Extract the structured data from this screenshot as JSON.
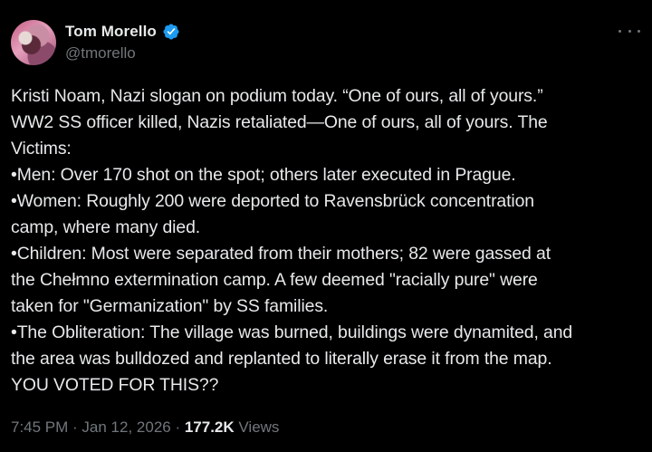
{
  "user": {
    "display_name": "Tom Morello",
    "handle": "@tmorello",
    "verified_color": "#1d9bf0"
  },
  "tweet": {
    "lines": [
      "Kristi Noam, Nazi slogan on podium today. “One of ours, all of yours.”",
      "WW2 SS officer killed, Nazis retaliated—One of ours, all of yours. The",
      "Victims:",
      "•Men: Over 170 shot on the spot; others later executed in Prague.",
      "•Women: Roughly 200 were deported to Ravensbrück concentration",
      "camp, where many died.",
      "•Children: Most were separated from their mothers; 82 were gassed at",
      "the Chełmno extermination camp. A few deemed \"racially pure\" were",
      "taken for \"Germanization\" by SS families.",
      "•The Obliteration: The village was burned, buildings were dynamited, and",
      "the area was bulldozed and replanted to literally erase it from the map.",
      "YOU VOTED FOR THIS??"
    ]
  },
  "meta": {
    "time": "7:45 PM",
    "sep1": " · ",
    "date": "Jan 12, 2026",
    "sep2": " · ",
    "views_count": "177.2K",
    "views_label": " Views"
  },
  "icons": {
    "verified": "verified-badge-icon",
    "more": "more-options-icon"
  }
}
